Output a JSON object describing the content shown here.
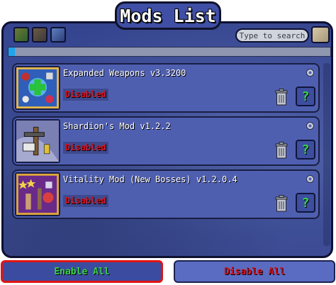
{
  "title": "Mods List",
  "toolbar": {
    "icons": [
      "sort-icon",
      "folder-icon",
      "filter-icon"
    ],
    "search_placeholder": "Type to search",
    "search_button_icon": "search-icon"
  },
  "progress": {
    "fraction": 0.02,
    "color": "#1ea5f0"
  },
  "mods": [
    {
      "name": "Expanded Weapons v3.3200",
      "status": "Disabled",
      "help_label": "?"
    },
    {
      "name": "Shardion's Mod v1.2.2",
      "status": "Disabled",
      "help_label": "?"
    },
    {
      "name": "Vitality Mod (New Bosses) v1.2.0.4",
      "status": "Disabled",
      "help_label": "?"
    }
  ],
  "buttons": {
    "enable_all": "Enable All",
    "disable_all": "Disable All"
  },
  "colors": {
    "enabled_text": "#39d241",
    "disabled_text": "#d21520",
    "selection_border": "#e01414"
  }
}
